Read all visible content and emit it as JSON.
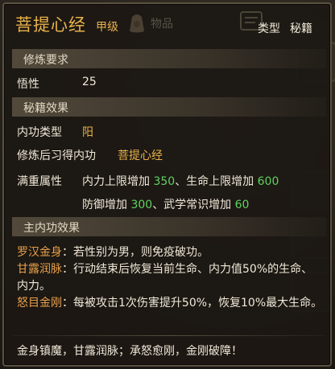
{
  "header": {
    "title": "菩提心经",
    "grade": "甲级",
    "background_tab_label": "物品",
    "type_label": "类型",
    "type_value": "秘籍"
  },
  "sections": {
    "requirement": {
      "label": "修炼要求",
      "rows": [
        {
          "key": "悟性",
          "value": "25"
        }
      ]
    },
    "effect": {
      "label": "秘籍效果",
      "internal_type_key": "内功类型",
      "internal_type_value": "阳",
      "learn_key": "修炼后习得内功",
      "learn_value": "菩提心经",
      "max_key": "满重属性",
      "max_lines": [
        [
          {
            "text": "内力上限增加 ",
            "color": "normal"
          },
          {
            "text": "350",
            "color": "green"
          },
          {
            "text": "、生命上限增加 ",
            "color": "normal"
          },
          {
            "text": "600",
            "color": "green"
          }
        ],
        [
          {
            "text": "防御增加 ",
            "color": "normal"
          },
          {
            "text": "300",
            "color": "green"
          },
          {
            "text": "、武学常识增加 ",
            "color": "normal"
          },
          {
            "text": "60",
            "color": "green"
          }
        ]
      ]
    },
    "internal": {
      "label": "主内功效果",
      "skills": [
        {
          "name": "罗汉金身",
          "desc": "：若性别为男，则免疫破功。"
        },
        {
          "name": "甘露润脉",
          "desc": "：行动结束后恢复当前生命、内力值50%的生命、内力。"
        },
        {
          "name": "怒目金刚",
          "desc": "：每被攻击1次伤害提升50%，恢复10%最大生命。"
        }
      ]
    }
  },
  "flavor_text": "金身镇魔，甘露润脉；承怒愈刚，金刚破障！",
  "colors": {
    "title": "#e8b24a",
    "value_green": "#5fd35f",
    "skill_name": "#e8a04a",
    "text": "#f0e8d8"
  }
}
